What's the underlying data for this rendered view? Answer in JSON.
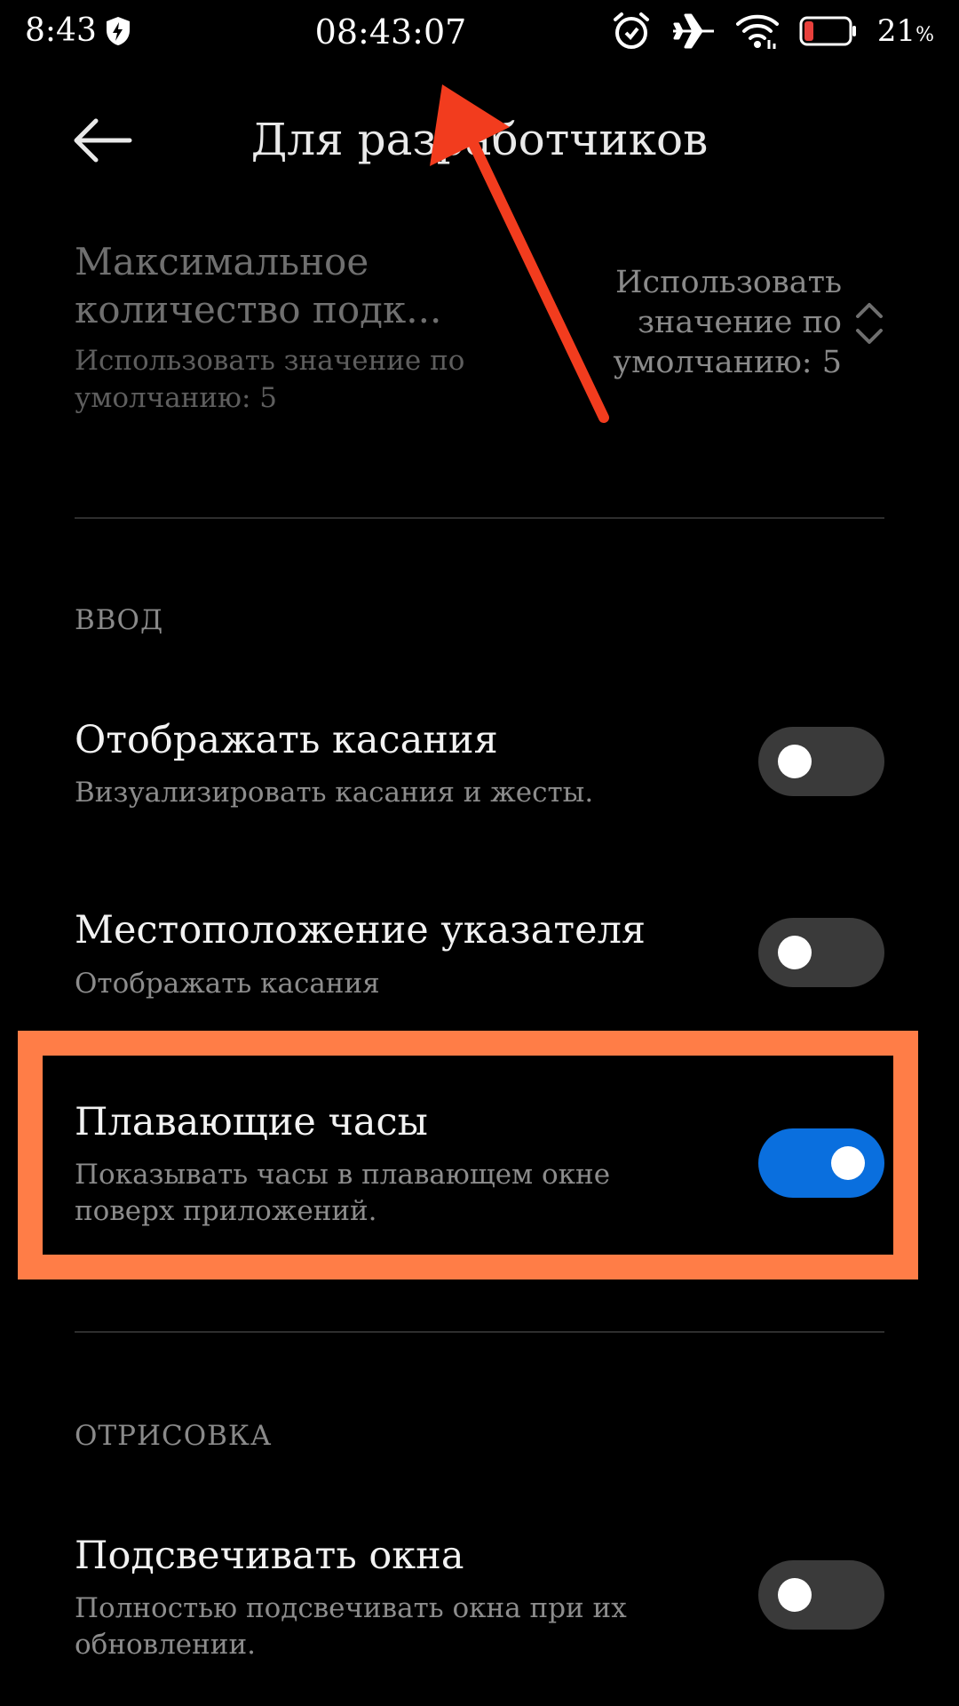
{
  "status_bar": {
    "time": "8:43",
    "clock": "08:43:07",
    "battery_percent": "21",
    "battery_unit": "%",
    "battery_level": 0.21,
    "colors": {
      "battery_low": "#e8403c"
    }
  },
  "header": {
    "title": "Для разработчиков"
  },
  "disabled_setting": {
    "title": "Максимальное количество подк...",
    "subtitle": "Использовать значение по умолчанию: 5",
    "value": "Использовать значение по умолчанию: 5"
  },
  "sections": {
    "input_header": "ВВОД",
    "drawing_header": "ОТРИСОВКА"
  },
  "settings": [
    {
      "title": "Отображать касания",
      "subtitle": "Визуализировать касания и жесты.",
      "enabled": false
    },
    {
      "title": "Местоположение указателя",
      "subtitle": "Отображать касания",
      "enabled": false
    },
    {
      "title": "Плавающие часы",
      "subtitle": "Показывать часы в плавающем окне поверх приложений.",
      "enabled": true
    },
    {
      "title": "Подсвечивать окна",
      "subtitle": "Полностью подсвечивать окна при их обновлении.",
      "enabled": false
    }
  ],
  "colors": {
    "background": "#000000",
    "toggle_on": "#0a6fde",
    "toggle_off": "#3a3a3a",
    "highlight": "#ff7d47",
    "arrow": "#f23c1e"
  }
}
